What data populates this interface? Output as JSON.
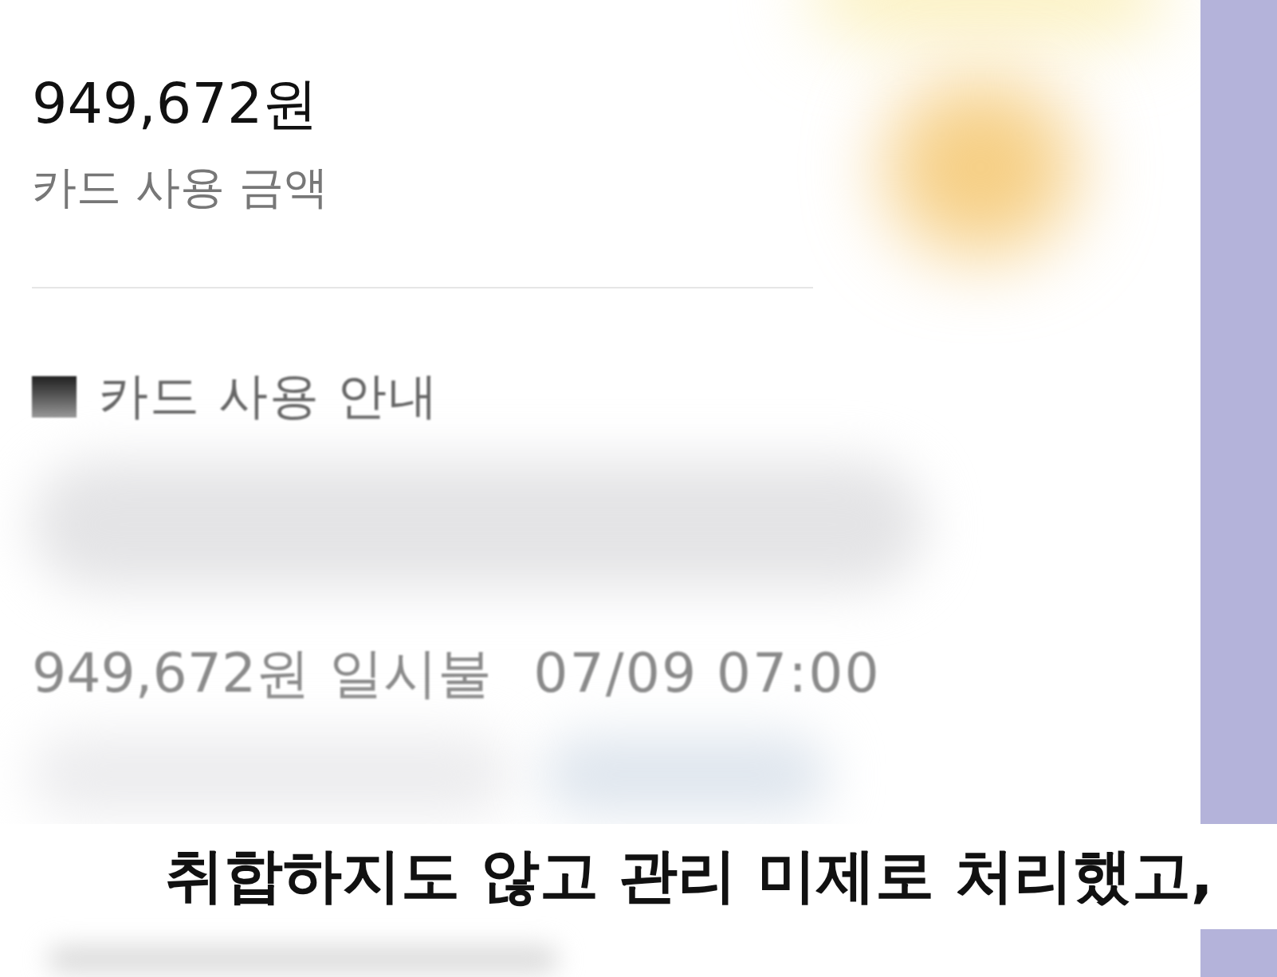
{
  "summary": {
    "amount": "949,672원",
    "label": "카드 사용 금액"
  },
  "notice": {
    "title": "카드 사용 안내",
    "amount": "949,672원",
    "payment": "일시불",
    "datetime": "07/09 07:00"
  },
  "subtitle": "취합하지도 않고 관리 미제로 처리했고,"
}
